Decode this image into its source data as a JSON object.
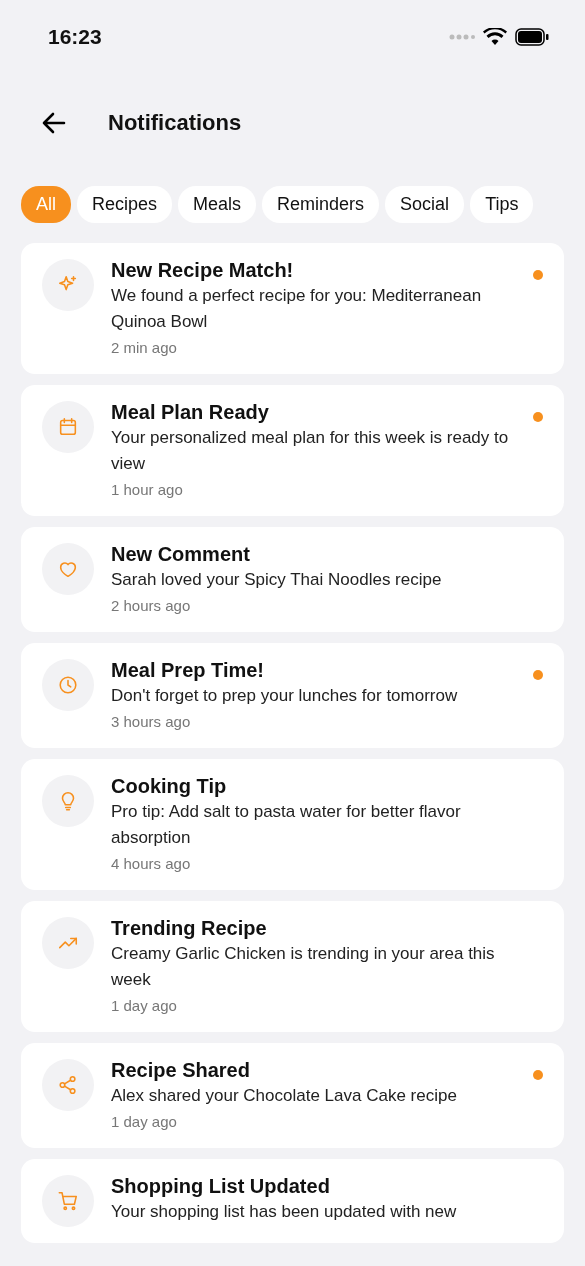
{
  "status_bar": {
    "time": "16:23"
  },
  "header": {
    "title": "Notifications"
  },
  "filters": [
    {
      "label": "All",
      "selected": true
    },
    {
      "label": "Recipes",
      "selected": false
    },
    {
      "label": "Meals",
      "selected": false
    },
    {
      "label": "Reminders",
      "selected": false
    },
    {
      "label": "Social",
      "selected": false
    },
    {
      "label": "Tips",
      "selected": false
    }
  ],
  "notifications": [
    {
      "kind": "sparkle",
      "title": "New Recipe Match!",
      "body": "We found a perfect recipe for you: Mediterranean Quinoa Bowl",
      "time": "2 min ago",
      "unread": true
    },
    {
      "kind": "calendar",
      "title": "Meal Plan Ready",
      "body": "Your personalized meal plan for this week is ready to view",
      "time": "1 hour ago",
      "unread": true
    },
    {
      "kind": "heart",
      "title": "New Comment",
      "body": "Sarah loved your Spicy Thai Noodles recipe",
      "time": "2 hours ago",
      "unread": false
    },
    {
      "kind": "clock",
      "title": "Meal Prep Time!",
      "body": "Don't forget to prep your lunches for tomorrow",
      "time": "3 hours ago",
      "unread": true
    },
    {
      "kind": "bulb",
      "title": "Cooking Tip",
      "body": "Pro tip: Add salt to pasta water for better flavor absorption",
      "time": "4 hours ago",
      "unread": false
    },
    {
      "kind": "trend",
      "title": "Trending Recipe",
      "body": "Creamy Garlic Chicken is trending in your area this week",
      "time": "1 day ago",
      "unread": false
    },
    {
      "kind": "share",
      "title": "Recipe Shared",
      "body": "Alex shared your Chocolate Lava Cake recipe",
      "time": "1 day ago",
      "unread": true
    },
    {
      "kind": "cart",
      "title": "Shopping List Updated",
      "body": "Your shopping list has been updated with new",
      "unread": false
    }
  ]
}
